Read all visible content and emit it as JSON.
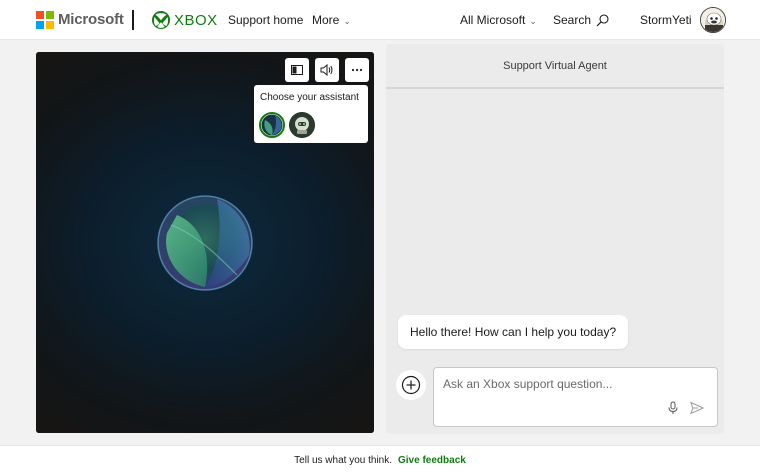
{
  "header": {
    "brand": "Microsoft",
    "product": "XBOX",
    "nav": {
      "support_home": "Support home",
      "more": "More"
    },
    "all_microsoft": "All Microsoft",
    "search": "Search",
    "username": "StormYeti",
    "icons": {
      "ms_logo": "microsoft-logo",
      "xbox_logo": "xbox-logo",
      "search": "search-icon",
      "avatar": "avatar-yeti"
    },
    "logo_colors": [
      "#f25022",
      "#7fba00",
      "#00a4ef",
      "#ffb900"
    ],
    "brand_color": "#107c10"
  },
  "video_panel": {
    "controls": {
      "layout_icon": "layout-toggle-icon",
      "volume_icon": "volume-icon",
      "more_icon": "more-options-icon"
    },
    "assistant_picker": {
      "title": "Choose your assistant",
      "options": [
        "orb-assistant",
        "robot-assistant"
      ],
      "selected": "orb-assistant"
    }
  },
  "chat": {
    "title": "Support Virtual Agent",
    "greeting": "Hello there! How can I help you today?",
    "input_placeholder": "Ask an Xbox support question...",
    "icons": {
      "add": "add-icon",
      "mic": "microphone-icon",
      "send": "send-icon"
    }
  },
  "footer": {
    "prompt": "Tell us what you think.",
    "link": "Give feedback"
  }
}
